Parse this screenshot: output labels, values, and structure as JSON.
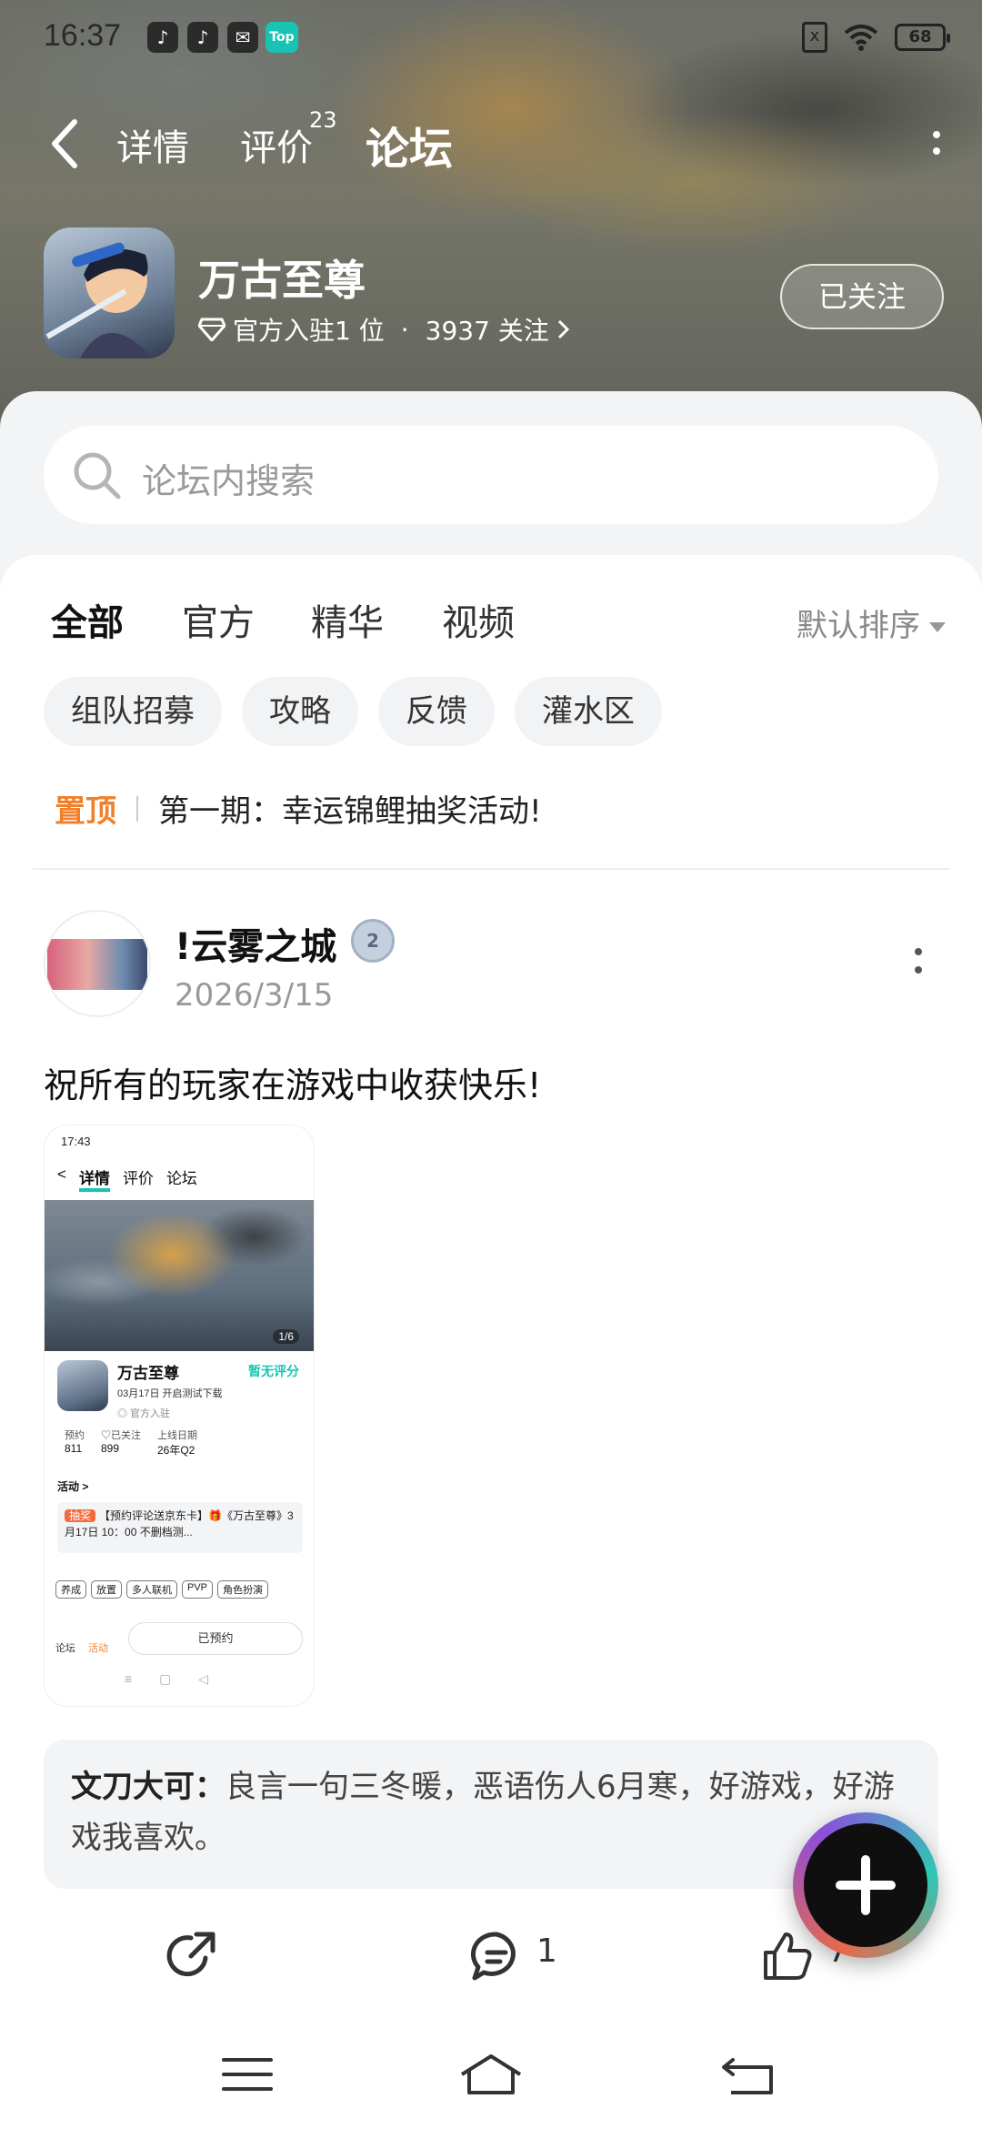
{
  "status_bar": {
    "time": "16:37",
    "notif_top_label": "Top",
    "sim_label": "x",
    "battery": "68"
  },
  "nav": {
    "tabs": [
      {
        "label": "详情"
      },
      {
        "label": "评价",
        "badge": "23"
      },
      {
        "label": "论坛"
      }
    ],
    "active_color": "#19c3b4"
  },
  "game": {
    "name": "万古至尊",
    "official_label": "官方入驻1 位",
    "separator": "·",
    "followers": "3937 关注",
    "follow_button": "已关注"
  },
  "search": {
    "placeholder": "论坛内搜索"
  },
  "filter": {
    "tabs": [
      "全部",
      "官方",
      "精华",
      "视频"
    ],
    "sort_label": "默认排序",
    "chips": [
      "组队招募",
      "攻略",
      "反馈",
      "灌水区"
    ]
  },
  "pinned": {
    "label": "置顶",
    "title": "第一期：幸运锦鲤抽奖活动!"
  },
  "post": {
    "author": "!云雾之城",
    "level": "2",
    "date": "2026/3/15",
    "text": "祝所有的玩家在游戏中收获快乐!",
    "comment_author": "文刀大可：",
    "comment_text": "良言一句三冬暖，恶语伤人6月寒，好游戏，好游戏我喜欢。",
    "comment_count": "1",
    "like_count": "7"
  },
  "thumbnail": {
    "status_time": "17:43",
    "nav": [
      "详情",
      "评价",
      "论坛"
    ],
    "page": "1/6",
    "game_name": "万古至尊",
    "no_score": "暂无评分",
    "sub": "03月17日 开启测试下载",
    "official": "◎ 官方入驻",
    "stats": [
      {
        "label": "预约",
        "value": "811"
      },
      {
        "label": "♡已关注",
        "value": "899"
      },
      {
        "label": "上线日期",
        "value": "26年Q2"
      }
    ],
    "activity": "活动 >",
    "promo_tag": "抽奖",
    "promo_text": "【预约评论送京东卡】🎁《万古至尊》3月17日 10：00 不删档测...",
    "tags": [
      "养成",
      "放置",
      "多人联机",
      "PVP",
      "角色扮演"
    ],
    "forum": "论坛",
    "act": "活动",
    "booked": "已预约"
  }
}
